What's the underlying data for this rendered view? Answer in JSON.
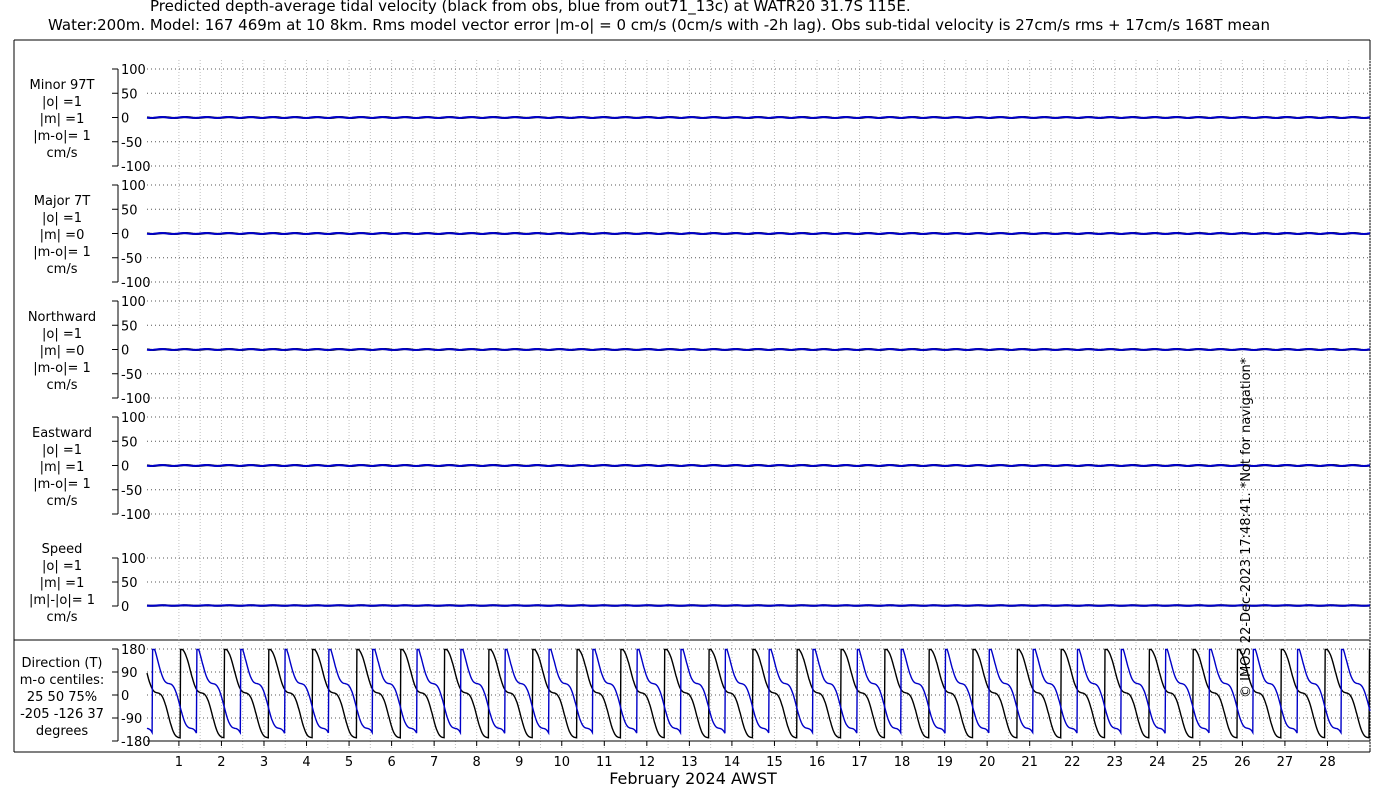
{
  "title_line1": "Predicted depth-average tidal velocity (black from obs, blue from out71_13c) at WATR20 31.7S 115E.",
  "title_line2": "Water:200m. Model: 167 469m at 10 8km. Rms model vector error |m-o| = 0 cm/s (0cm/s with -2h lag). Obs sub-tidal velocity is 27cm/s rms + 17cm/s 168T mean",
  "copyright": "© IMOS 22-Dec-2023 17:48:41. *Not for navigation*",
  "colors": {
    "obs": "#000000",
    "model": "#0000c8",
    "grid": "#bfbfbf"
  },
  "chart_data": {
    "type": "line",
    "xlabel": "February 2024 AWST",
    "x_ticks": [
      "1",
      "2",
      "3",
      "4",
      "5",
      "6",
      "7",
      "8",
      "9",
      "10",
      "11",
      "12",
      "13",
      "14",
      "15",
      "16",
      "17",
      "18",
      "19",
      "20",
      "21",
      "22",
      "23",
      "24",
      "25",
      "26",
      "27",
      "28"
    ],
    "xlim_days": [
      0.25,
      29.0
    ],
    "grid": true,
    "panels": [
      {
        "name": "minor",
        "labels": [
          "Minor 97T",
          "|o| =1",
          "|m| =1",
          "|m-o|= 1",
          "cm/s"
        ],
        "yticks": [
          "100",
          "50",
          "0",
          "-50",
          "-100"
        ],
        "ylim": [
          -100,
          100
        ],
        "obs_level": 0,
        "model_level": 0,
        "ripple": 1
      },
      {
        "name": "major",
        "labels": [
          "Major 7T",
          "|o| =1",
          "|m| =0",
          "|m-o|= 1",
          "cm/s"
        ],
        "yticks": [
          "100",
          "50",
          "0",
          "-50",
          "-100"
        ],
        "ylim": [
          -100,
          100
        ],
        "obs_level": 0,
        "model_level": 0,
        "ripple": 1
      },
      {
        "name": "northward",
        "labels": [
          "Northward",
          "|o| =1",
          "|m| =0",
          "|m-o|= 1",
          "cm/s"
        ],
        "yticks": [
          "100",
          "50",
          "0",
          "-50",
          "-100"
        ],
        "ylim": [
          -100,
          100
        ],
        "obs_level": 0,
        "model_level": 0,
        "ripple": 1
      },
      {
        "name": "eastward",
        "labels": [
          "Eastward",
          "|o| =1",
          "|m| =1",
          "|m-o|= 1",
          "cm/s"
        ],
        "yticks": [
          "100",
          "50",
          "0",
          "-50",
          "-100"
        ],
        "ylim": [
          -100,
          100
        ],
        "obs_level": 0,
        "model_level": 0,
        "ripple": 1
      },
      {
        "name": "speed",
        "labels": [
          "Speed",
          "|o| =1",
          "|m| =1",
          "|m|-|o|= 1",
          "cm/s"
        ],
        "yticks": [
          "100",
          "50",
          "0"
        ],
        "ylim": [
          0,
          100
        ],
        "obs_level": 1,
        "model_level": 1,
        "ripple": 0.5
      },
      {
        "name": "direction",
        "labels": [
          "Direction (T)",
          "m-o centiles:",
          "25  50  75%",
          "-205 -126   37",
          "degrees"
        ],
        "yticks": [
          "180",
          "90",
          "0",
          "-90",
          "-180"
        ],
        "ylim": [
          -180,
          180
        ],
        "period_days": 1.035,
        "obs_phase": 0.0,
        "model_phase": 0.38
      }
    ]
  }
}
